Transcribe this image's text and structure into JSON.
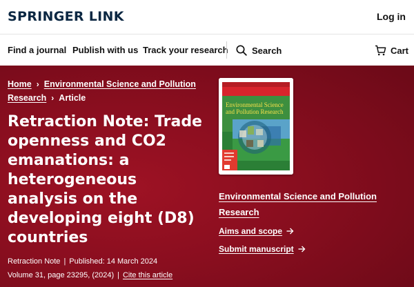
{
  "header": {
    "logo": "SPRINGER LINK",
    "login": "Log in"
  },
  "nav": {
    "find_journal": "Find a journal",
    "publish": "Publish with us",
    "track": "Track your research",
    "search": "Search",
    "cart": "Cart"
  },
  "breadcrumb": {
    "home": "Home",
    "journal_line1": "Environmental Science and Pollution",
    "journal_line2": "Research",
    "article": "Article"
  },
  "article": {
    "title": "Retraction Note: Trade openness and CO2 emanations: a heterogeneous analysis on the developing eight (D8) countries",
    "type": "Retraction Note",
    "published": "Published: 14 March 2024",
    "volume": "Volume 31, page 23295, (2024)",
    "cite": "Cite this article"
  },
  "sidebar": {
    "cover_title": "Environmental Science and Pollution Research",
    "journal_name": "Environmental Science and Pollution Research",
    "aims": "Aims and scope",
    "submit": "Submit manuscript"
  },
  "colors": {
    "brand_navy": "#0b2742",
    "hero_red": "#8a0e1f",
    "cover_green": "#2f8a3c",
    "cover_red": "#c1272d"
  },
  "icons": {
    "search": "magnifier-icon",
    "cart": "cart-icon",
    "breadcrumb_separator": "chevron-right-icon",
    "link_arrow": "arrow-right-icon"
  }
}
